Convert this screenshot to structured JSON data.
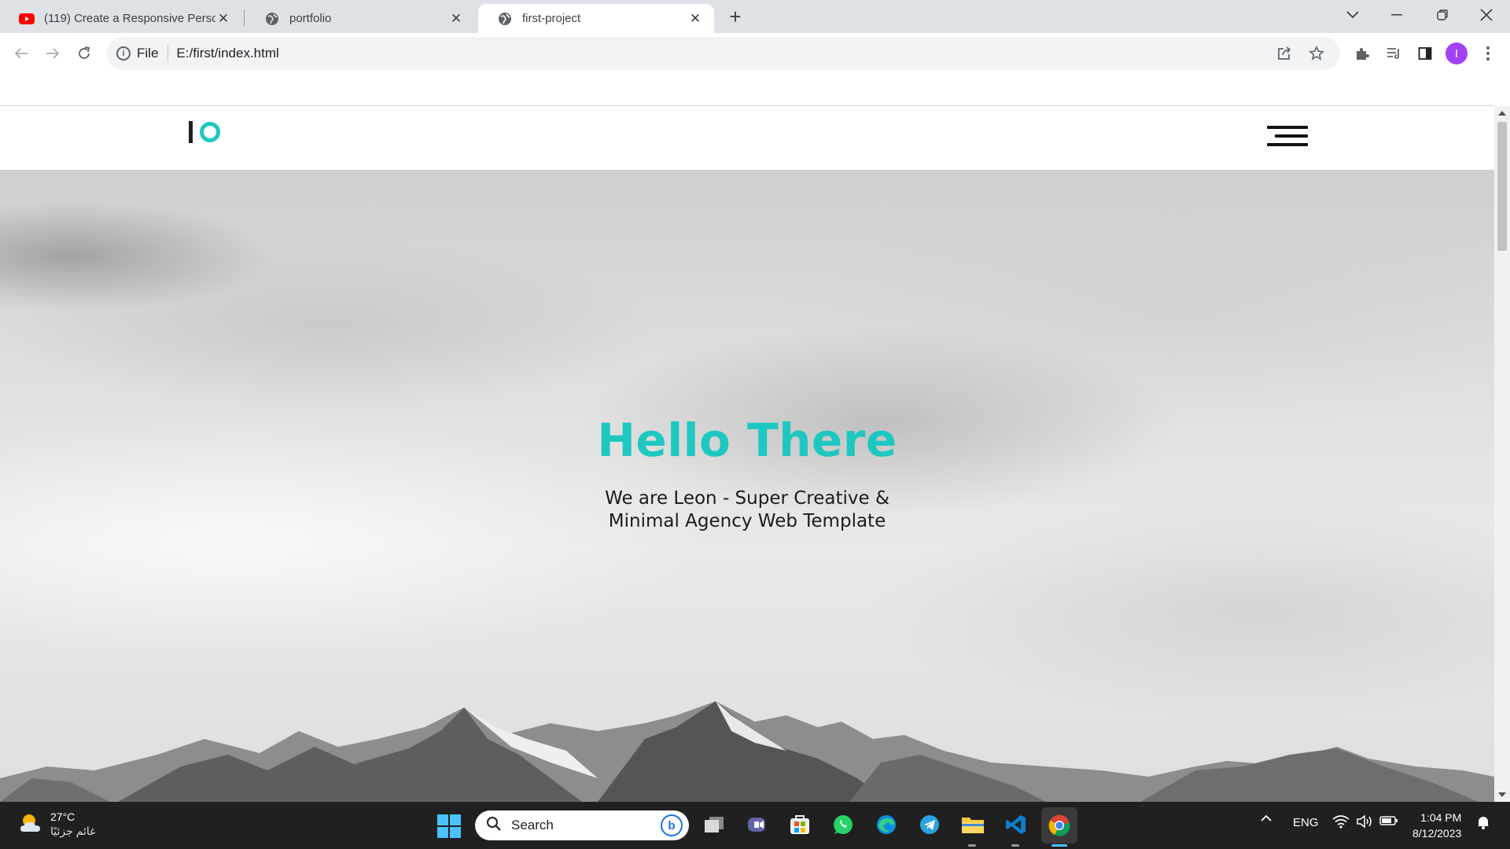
{
  "browser": {
    "tabs": [
      {
        "title": "(119) Create a Responsive Personal",
        "favicon": "youtube-icon",
        "active": false
      },
      {
        "title": "portfolio",
        "favicon": "globe-icon",
        "active": false
      },
      {
        "title": "first-project",
        "favicon": "globe-icon",
        "active": true
      }
    ],
    "address": {
      "scheme_label": "File",
      "url": "E:/first/index.html"
    },
    "profile_initial": "I"
  },
  "page": {
    "logo_alt": "IO",
    "hero": {
      "title": "Hello There",
      "subtitle": "We are Leon - Super Creative & Minimal Agency Web Template"
    },
    "colors": {
      "accent": "#1ec8c0",
      "text_dark": "#1c1c1c"
    }
  },
  "taskbar": {
    "weather": {
      "temperature": "27°C",
      "condition": "غائم جزئيًا"
    },
    "search_placeholder": "Search",
    "pinned_apps": [
      "file-explorer-icon",
      "teams-icon",
      "microsoft-store-icon",
      "whatsapp-icon",
      "edge-icon",
      "telegram-icon",
      "folder-icon",
      "vscode-icon",
      "chrome-icon"
    ],
    "language": "ENG",
    "time": "1:04 PM",
    "date": "8/12/2023"
  }
}
